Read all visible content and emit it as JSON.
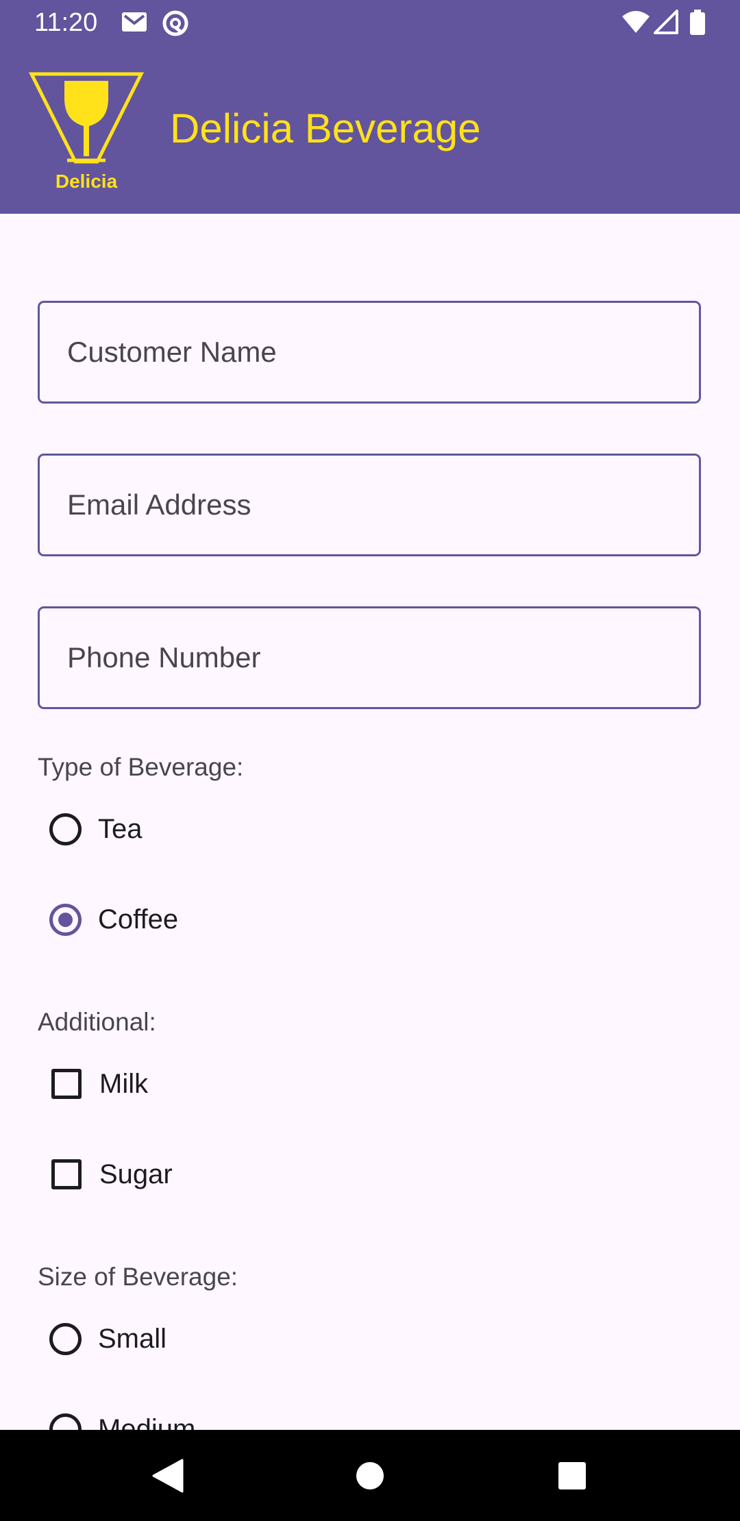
{
  "status_bar": {
    "time": "11:20",
    "left_icons": [
      "gmail-icon",
      "at-sign-notification-icon"
    ],
    "right_icons": [
      "wifi-icon",
      "signal-icon",
      "battery-icon"
    ]
  },
  "app_bar": {
    "logo_text": "Delicia",
    "title": "Delicia Beverage",
    "background_color": "#63549E",
    "title_color": "#FFE21A"
  },
  "form": {
    "customer_name": {
      "placeholder": "Customer Name",
      "value": ""
    },
    "email": {
      "placeholder": "Email Address",
      "value": ""
    },
    "phone": {
      "placeholder": "Phone Number",
      "value": ""
    },
    "beverage_type": {
      "label": "Type of Beverage:",
      "options": [
        {
          "label": "Tea",
          "checked": false
        },
        {
          "label": "Coffee",
          "checked": true
        }
      ]
    },
    "additional": {
      "label": "Additional:",
      "options": [
        {
          "label": "Milk",
          "checked": false
        },
        {
          "label": "Sugar",
          "checked": false
        }
      ]
    },
    "size": {
      "label": "Size of Beverage:",
      "options": [
        {
          "label": "Small",
          "checked": false
        },
        {
          "label": "Medium",
          "checked": false
        }
      ]
    }
  },
  "nav_bar": {
    "buttons": [
      "back-icon",
      "home-icon",
      "recents-icon"
    ]
  },
  "colors": {
    "accent": "#63549E",
    "background": "#FEF7FF",
    "brand_yellow": "#FFE21A"
  }
}
